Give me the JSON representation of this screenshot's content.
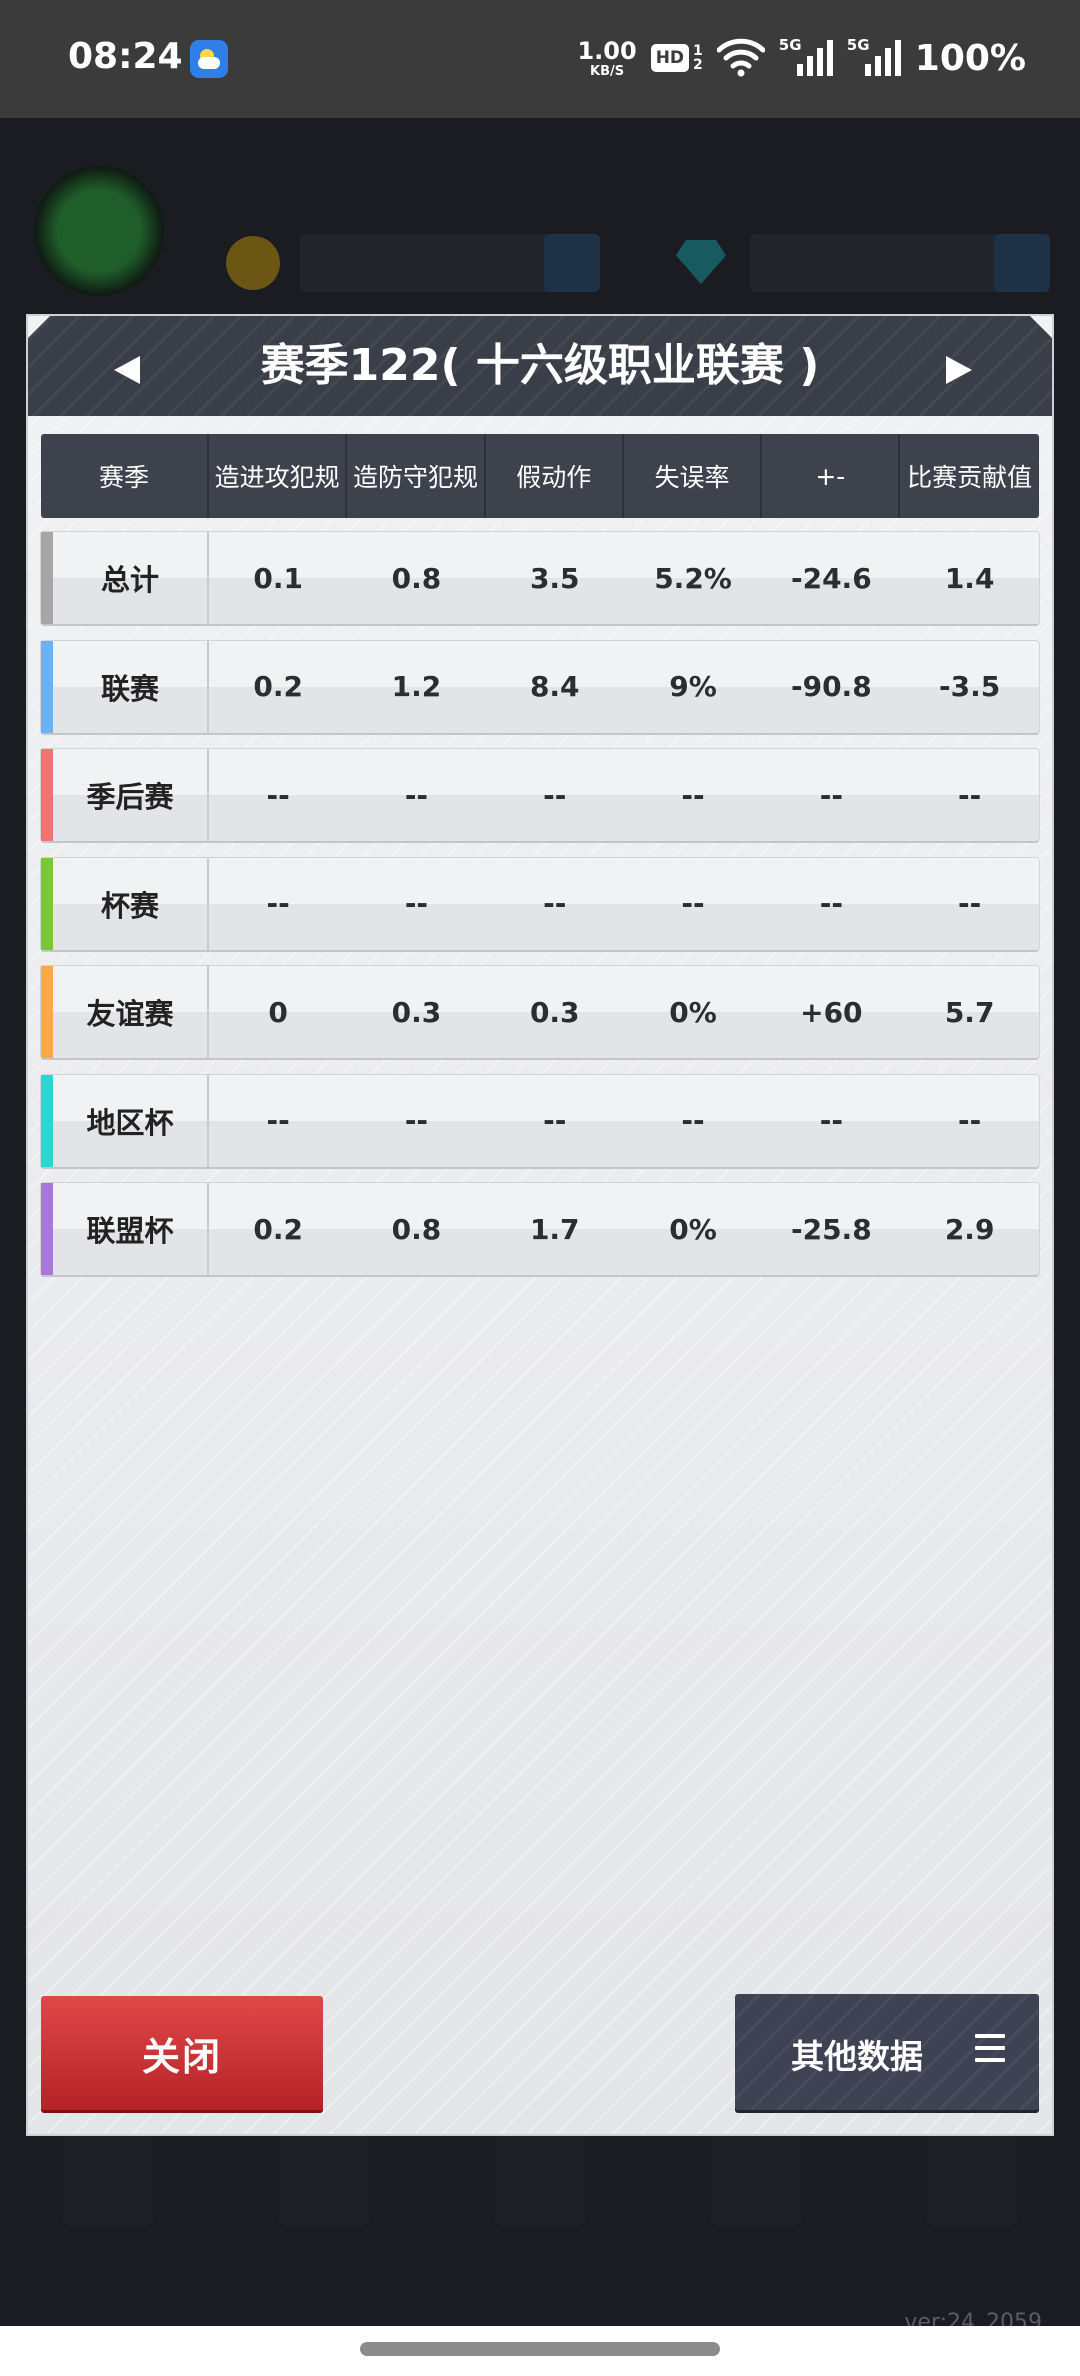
{
  "status_bar": {
    "time": "08:24",
    "net_speed_value": "1.00",
    "net_speed_unit": "KB/S",
    "hd_label": "HD",
    "sim1": "1",
    "sim2": "2",
    "sig1_label": "5G",
    "sig2_label": "5G",
    "battery": "100%"
  },
  "background": {
    "version": "ver:24_2059"
  },
  "dialog": {
    "title": "赛季122( 十六级职业联赛 )",
    "headers": [
      "赛季",
      "造进攻犯规",
      "造防守犯规",
      "假动作",
      "失误率",
      "+-",
      "比赛贡献值"
    ],
    "rows": [
      {
        "label": "总计",
        "color": "#a6a6a6",
        "values": [
          "0.1",
          "0.8",
          "3.5",
          "5.2%",
          "-24.6",
          "1.4"
        ]
      },
      {
        "label": "联赛",
        "color": "#6db1f2",
        "values": [
          "0.2",
          "1.2",
          "8.4",
          "9%",
          "-90.8",
          "-3.5"
        ]
      },
      {
        "label": "季后赛",
        "color": "#f07474",
        "values": [
          "--",
          "--",
          "--",
          "--",
          "--",
          "--"
        ]
      },
      {
        "label": "杯赛",
        "color": "#7cc63a",
        "values": [
          "--",
          "--",
          "--",
          "--",
          "--",
          "--"
        ]
      },
      {
        "label": "友谊赛",
        "color": "#f8a94a",
        "values": [
          "0",
          "0.3",
          "0.3",
          "0%",
          "+60",
          "5.7"
        ]
      },
      {
        "label": "地区杯",
        "color": "#26d8d0",
        "values": [
          "--",
          "--",
          "--",
          "--",
          "--",
          "--"
        ]
      },
      {
        "label": "联盟杯",
        "color": "#a878d8",
        "values": [
          "0.2",
          "0.8",
          "1.7",
          "0%",
          "-25.8",
          "2.9"
        ]
      }
    ],
    "close_label": "关闭",
    "other_label": "其他数据"
  }
}
